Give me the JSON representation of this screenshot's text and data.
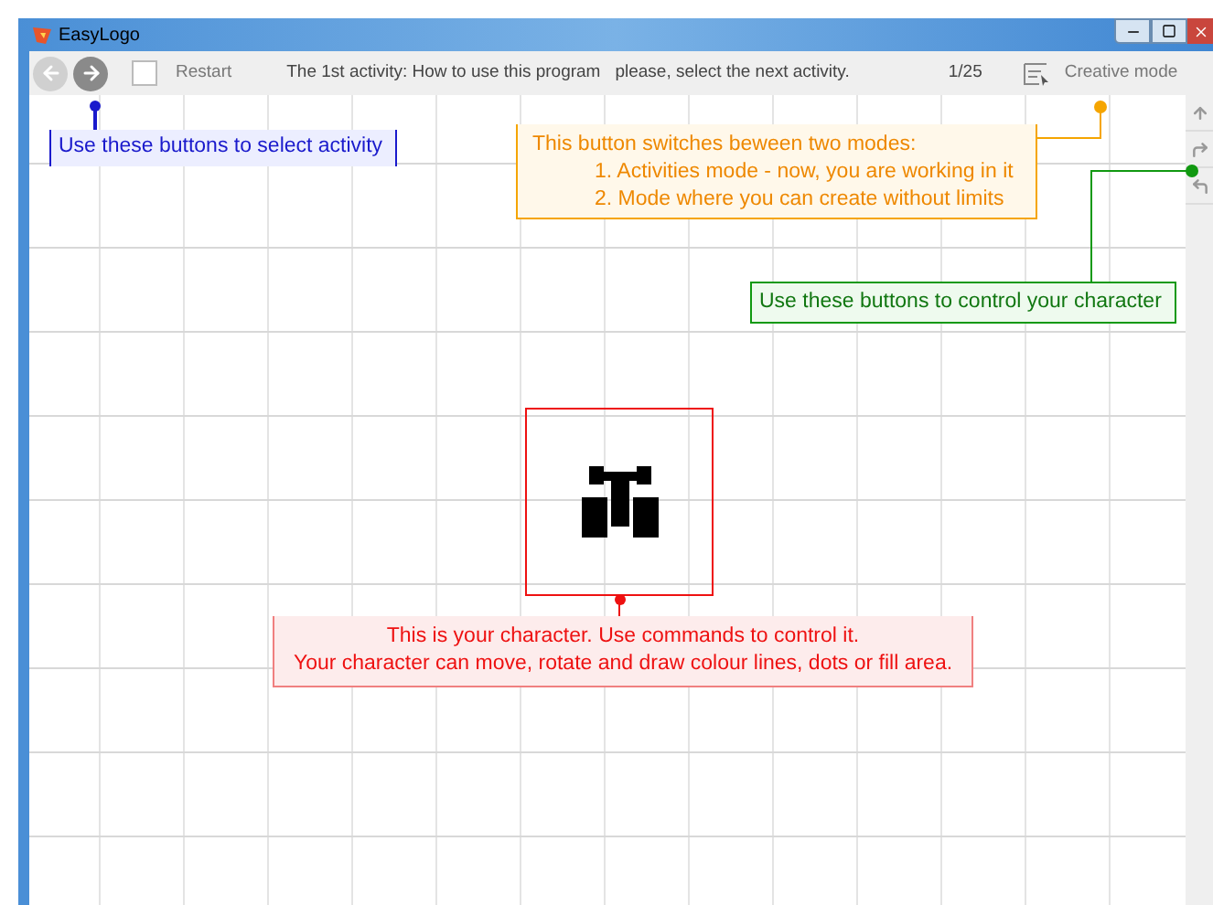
{
  "window": {
    "title": "EasyLogo"
  },
  "toolbar": {
    "restart": "Restart",
    "restart_checked": false,
    "activity": "The 1st activity: How to use this program",
    "hint": "please, select the next activity.",
    "progress": "1/25",
    "mode": "Creative mode"
  },
  "callouts": [
    {
      "kind": "select",
      "color": "#1a1acc",
      "lines": [
        "Use these buttons to select activity"
      ]
    },
    {
      "kind": "modes",
      "color": "#f5a500",
      "lines": [
        "This button switches beween two modes:",
        "1. Activities mode - now, you are working in it",
        "2. Mode where you can create without limits"
      ]
    },
    {
      "kind": "control",
      "color": "#119911",
      "lines": [
        "Use these buttons to control your character"
      ]
    },
    {
      "kind": "character",
      "color": "#ee1111",
      "lines": [
        "This is your character. Use commands to control it.",
        "Your character can move, rotate and draw colour lines, dots or fill area."
      ]
    }
  ]
}
